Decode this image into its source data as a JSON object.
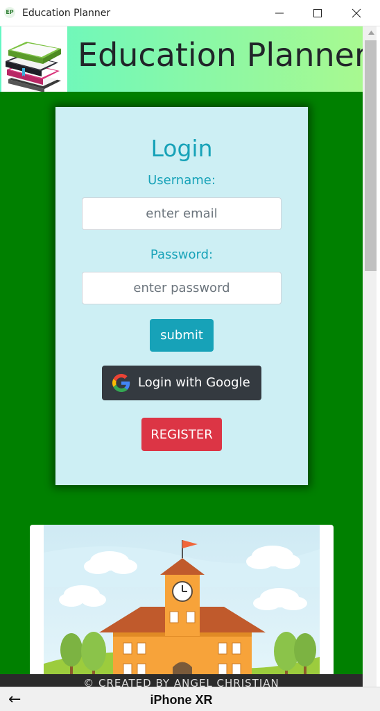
{
  "window": {
    "title": "Education Planner",
    "app_icon_text": "EP",
    "controls": [
      "minimize-icon",
      "maximize-icon",
      "close-icon"
    ]
  },
  "header": {
    "brand": "Education Planner",
    "logo_icon": "books-stack-icon",
    "gradient_colors": [
      "#64f7c3",
      "#a8f990"
    ]
  },
  "login": {
    "title": "Login",
    "username_label": "Username:",
    "username_placeholder": "enter email",
    "username_value": "",
    "password_label": "Password:",
    "password_placeholder": "enter password",
    "password_value": "",
    "submit_label": "submit",
    "google_label": "Login with Google",
    "google_icon": "google-g-icon",
    "register_label": "REGISTER"
  },
  "banner": {
    "image": "school-building-illustration"
  },
  "footer": {
    "text": "© CREATED BY ANGEL CHRISTIAN"
  },
  "device_toolbar": {
    "back_icon": "back-arrow-icon",
    "back_glyph": "←",
    "device": "iPhone XR"
  },
  "colors": {
    "page_background": "#008000",
    "card_background": "#cdeff4",
    "accent": "#17a2b8",
    "google_button": "#343a40",
    "register_button": "#dc3545"
  }
}
